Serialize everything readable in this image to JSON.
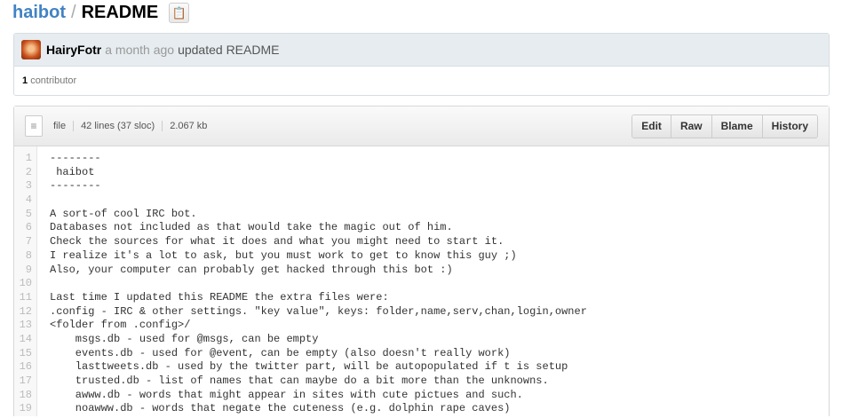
{
  "breadcrumb": {
    "repo": "haibot",
    "separator": "/",
    "file": "README"
  },
  "commit": {
    "author": "HairyFotr",
    "time": "a month ago",
    "message": "updated README",
    "contributors_count": "1",
    "contributors_label": "contributor"
  },
  "file": {
    "type": "file",
    "lines": "42 lines (37 sloc)",
    "size": "2.067 kb"
  },
  "toolbar": {
    "edit": "Edit",
    "raw": "Raw",
    "blame": "Blame",
    "history": "History"
  },
  "code": [
    "--------",
    " haibot",
    "--------",
    "",
    "A sort-of cool IRC bot.",
    "Databases not included as that would take the magic out of him.",
    "Check the sources for what it does and what you might need to start it.",
    "I realize it's a lot to ask, but you must work to get to know this guy ;)",
    "Also, your computer can probably get hacked through this bot :)",
    "",
    "Last time I updated this README the extra files were:",
    ".config - IRC & other settings. \"key value\", keys: folder,name,serv,chan,login,owner",
    "<folder from .config>/",
    "    msgs.db - used for @msgs, can be empty",
    "    events.db - used for @event, can be empty (also doesn't really work)",
    "    lasttweets.db - used by the twitter part, will be autopopulated if t is setup",
    "    trusted.db - list of names that can maybe do a bit more than the unknowns.",
    "    awww.db - words that might appear in sites with cute pictues and such.",
    "    noawww.db - words that negate the cuteness (e.g. dolphin rape caves)"
  ]
}
